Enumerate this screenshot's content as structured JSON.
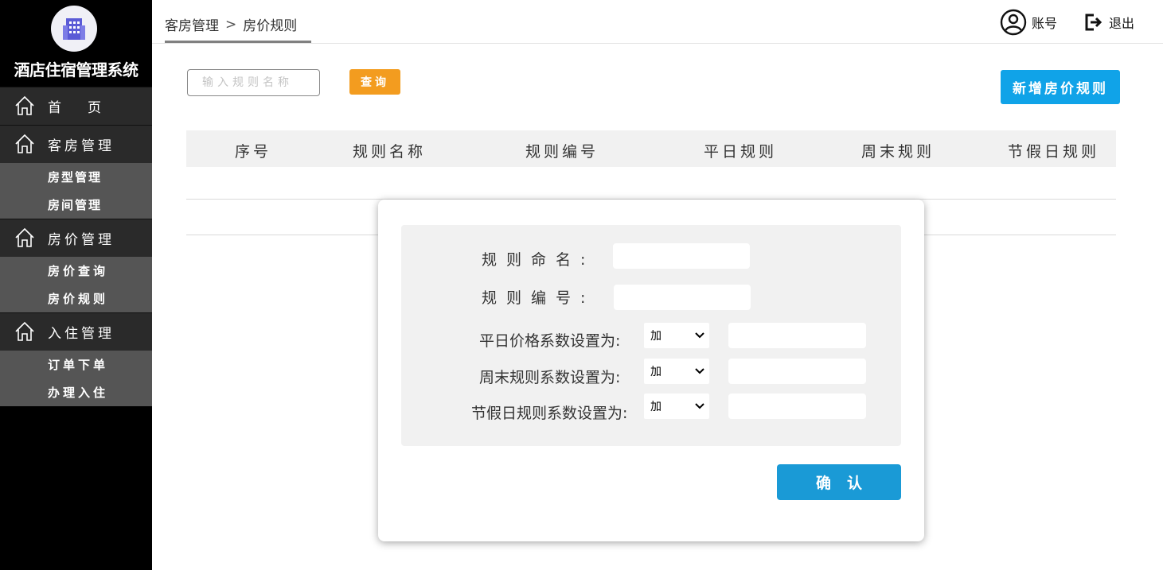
{
  "app": {
    "name": "酒店住宿管理系统",
    "logo_icon": "building-icon",
    "accent_color": "#10a3e8"
  },
  "sidebar": {
    "home": {
      "label_a": "首",
      "label_b": "页"
    },
    "groups": [
      {
        "label": "客房管理",
        "subitems": [
          "房型管理",
          "房间管理"
        ]
      },
      {
        "label": "房价管理",
        "subitems": [
          "房价查询",
          "房价规则"
        ]
      },
      {
        "label": "入住管理",
        "subitems": [
          "订单下单",
          "办理入住"
        ]
      }
    ]
  },
  "header": {
    "breadcrumb": [
      "客房管理",
      "房价规则"
    ],
    "breadcrumb_sep": ">",
    "account_label": "账号",
    "logout_label": "退出"
  },
  "toolbar": {
    "search_placeholder": "输入规则名称",
    "query_label": "查询",
    "add_label": "新增房价规则"
  },
  "table": {
    "columns": [
      "序号",
      "规则名称",
      "规则编号",
      "平日规则",
      "周末规则",
      "节假日规则"
    ],
    "rows": []
  },
  "modal": {
    "fields": {
      "rule_name_label": "规则命名:",
      "rule_code_label": "规则编号:",
      "weekday_label": "平日价格系数设置为:",
      "weekend_label": "周末规则系数设置为:",
      "holiday_label": "节假日规则系数设置为:"
    },
    "values": {
      "rule_name": "",
      "rule_code": "",
      "weekday_op": "加",
      "weekday_value": "",
      "weekend_op": "加",
      "weekend_value": "",
      "holiday_op": "加",
      "holiday_value": ""
    },
    "confirm_label": "确认"
  }
}
